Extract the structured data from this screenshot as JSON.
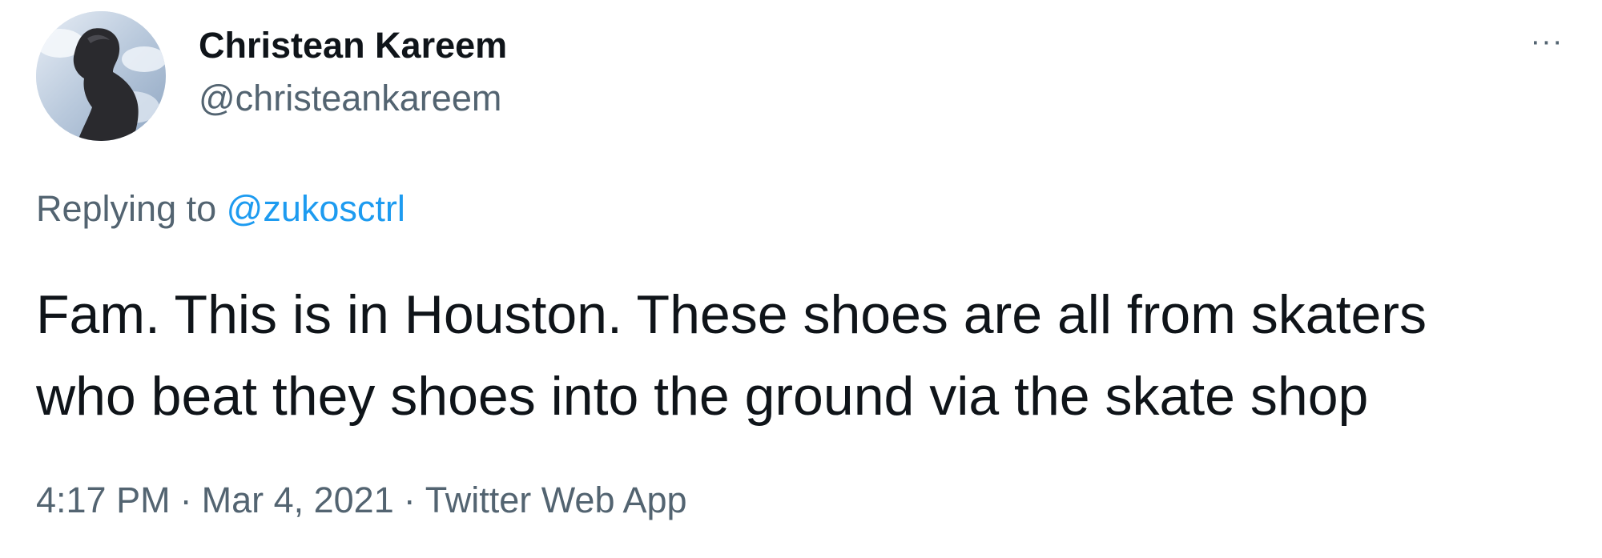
{
  "author": {
    "display_name": "Christean Kareem",
    "handle": "@christeankareem",
    "avatar_icon": "profile-photo"
  },
  "menu": {
    "more_icon": "more-dots-icon",
    "more_glyph": "···"
  },
  "reply": {
    "prefix": "Replying to",
    "mention": "@zukosctrl"
  },
  "tweet": {
    "lines": [
      "Fam. This is in Houston. These shoes are all from skaters",
      "who beat they shoes into the ground via the skate shop"
    ]
  },
  "meta": {
    "time": "4:17 PM",
    "date": "Mar 4, 2021",
    "source": "Twitter Web App",
    "separator": "·"
  },
  "colors": {
    "text_primary": "#0f1419",
    "text_secondary": "#536471",
    "link": "#1d9bf0",
    "background": "#ffffff"
  }
}
